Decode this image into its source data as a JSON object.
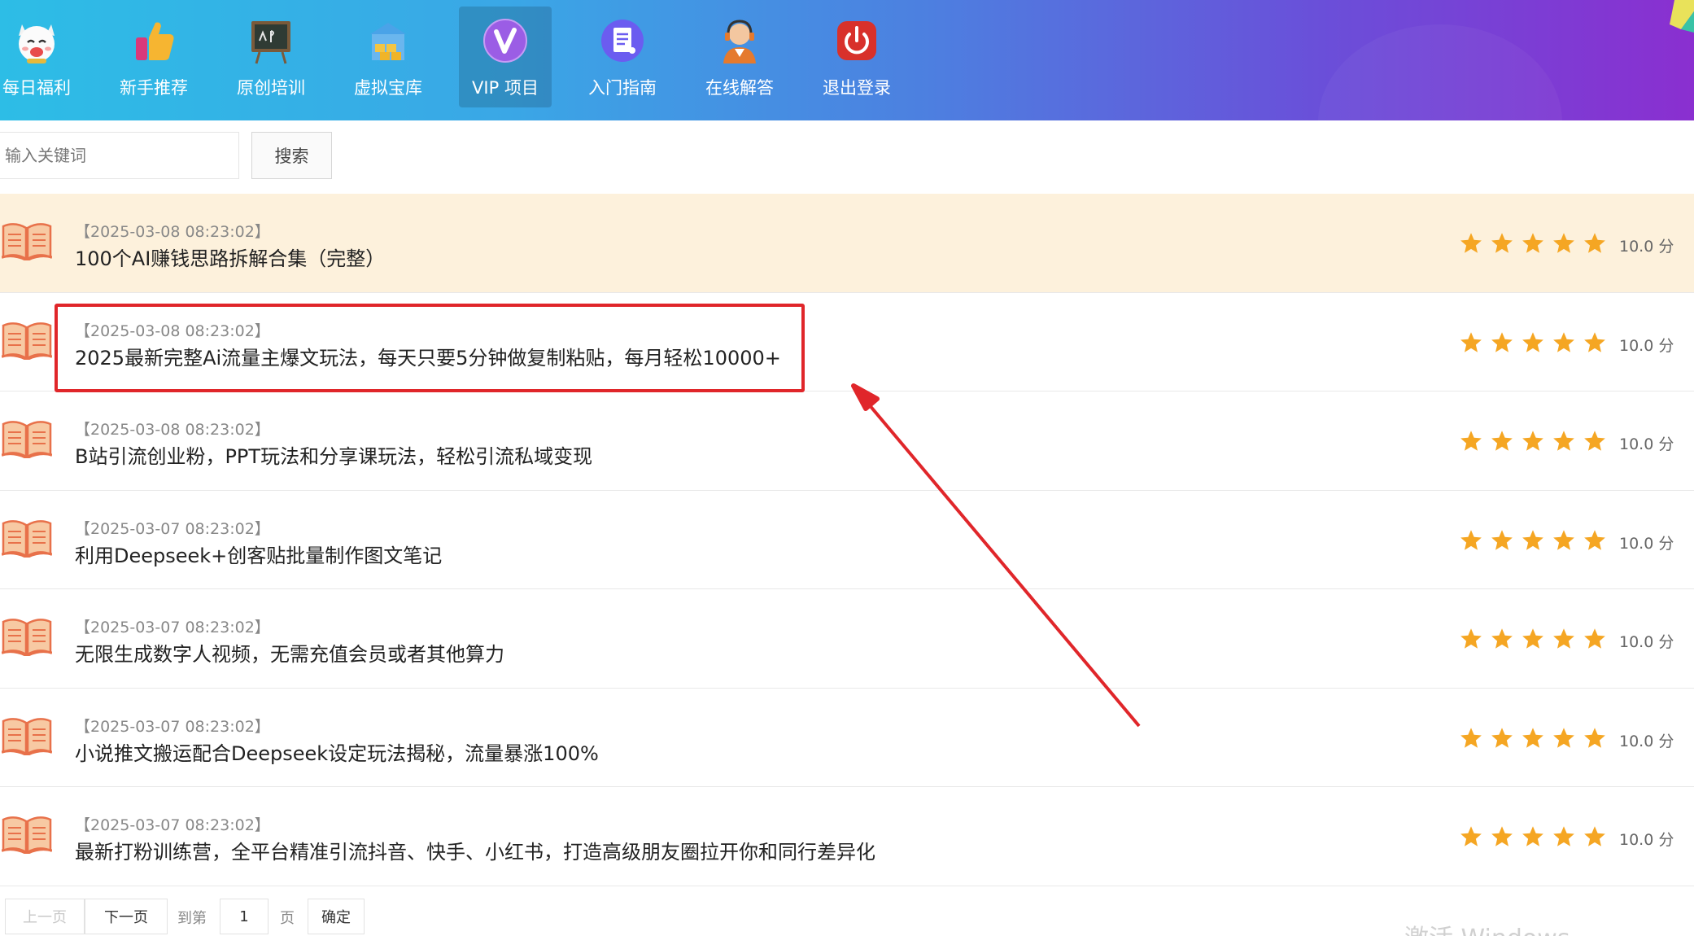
{
  "nav": {
    "items": [
      {
        "label": "每日福利",
        "icon": "lucky-cat-icon"
      },
      {
        "label": "新手推荐",
        "icon": "thumbs-up-icon"
      },
      {
        "label": "原创培训",
        "icon": "blackboard-icon"
      },
      {
        "label": "虚拟宝库",
        "icon": "treasure-building-icon"
      },
      {
        "label": "VIP 项目",
        "icon": "vip-icon",
        "active": true
      },
      {
        "label": "入门指南",
        "icon": "document-icon"
      },
      {
        "label": "在线解答",
        "icon": "support-agent-icon"
      },
      {
        "label": "退出登录",
        "icon": "power-icon"
      }
    ]
  },
  "search": {
    "placeholder": "输入关键词",
    "button_label": "搜索"
  },
  "list": {
    "items": [
      {
        "date": "【2025-03-08 08:23:02】",
        "title": "100个AI赚钱思路拆解合集（完整）",
        "score": "10.0 分",
        "stars": 5,
        "highlighted": true
      },
      {
        "date": "【2025-03-08 08:23:02】",
        "title": "2025最新完整Ai流量主爆文玩法，每天只要5分钟做复制粘贴，每月轻松10000+",
        "score": "10.0 分",
        "stars": 5
      },
      {
        "date": "【2025-03-08 08:23:02】",
        "title": "B站引流创业粉，PPT玩法和分享课玩法，轻松引流私域变现",
        "score": "10.0 分",
        "stars": 5
      },
      {
        "date": "【2025-03-07 08:23:02】",
        "title": "利用Deepseek+创客贴批量制作图文笔记",
        "score": "10.0 分",
        "stars": 5
      },
      {
        "date": "【2025-03-07 08:23:02】",
        "title": "无限生成数字人视频，无需充值会员或者其他算力",
        "score": "10.0 分",
        "stars": 5
      },
      {
        "date": "【2025-03-07 08:23:02】",
        "title": "小说推文搬运配合Deepseek设定玩法揭秘，流量暴涨100%",
        "score": "10.0 分",
        "stars": 5
      },
      {
        "date": "【2025-03-07 08:23:02】",
        "title": "最新打粉训练营，全平台精准引流抖音、快手、小红书，打造高级朋友圈拉开你和同行差异化",
        "score": "10.0 分",
        "stars": 5
      }
    ]
  },
  "pager": {
    "prev_label": "上一页",
    "next_label": "下一页",
    "goto_label": "到第",
    "page_value": "1",
    "page_unit": "页",
    "confirm_label": "确定"
  },
  "watermark": "激活 Windows",
  "colors": {
    "highlight_row": "#fdf1dc",
    "star": "#f5a623",
    "annotation": "#e0262a",
    "header_start": "#2dbde6",
    "header_end": "#8a2fd0"
  }
}
